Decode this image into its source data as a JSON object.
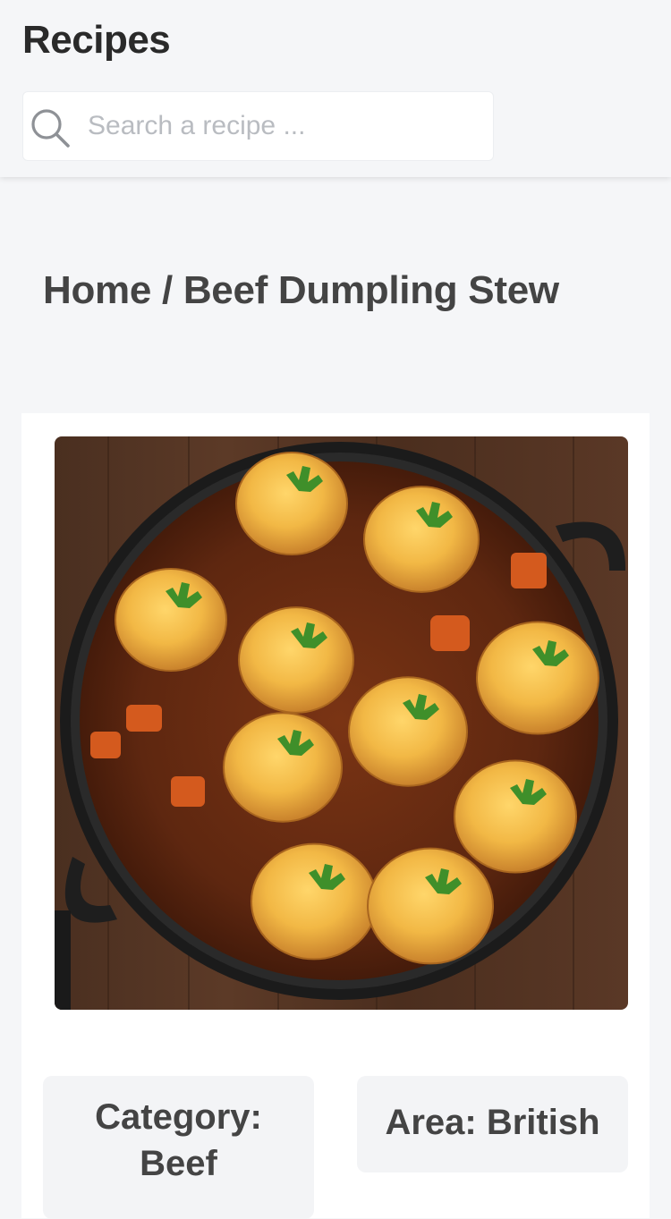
{
  "header": {
    "title": "Recipes",
    "search": {
      "placeholder": "Search a recipe ...",
      "value": ""
    }
  },
  "breadcrumb": {
    "home": "Home",
    "separator": " / ",
    "current": "Beef Dumpling Stew"
  },
  "recipe": {
    "image_alt": "Beef Dumpling Stew in a cast iron pan",
    "category_label": "Category:",
    "category_value": "Beef",
    "area_label": "Area: British"
  },
  "colors": {
    "background": "#f5f6f8",
    "card": "#ffffff",
    "tag_background": "#f3f4f6",
    "title_text": "#2a2a2a",
    "placeholder": "#b9bcc1"
  },
  "icons": {
    "search": "search-icon"
  }
}
